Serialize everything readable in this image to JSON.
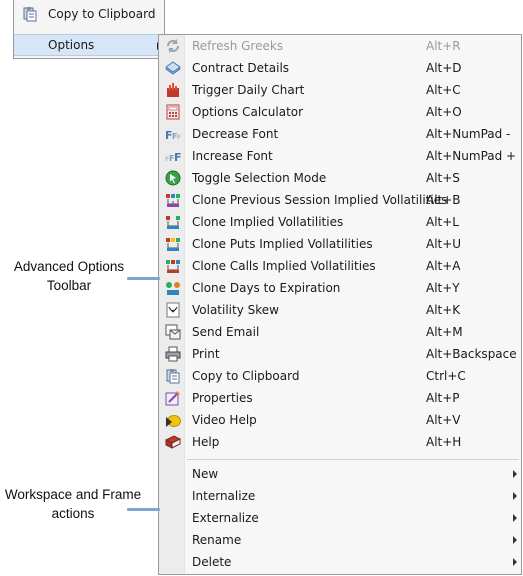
{
  "parent_menu": {
    "items": [
      {
        "label": "Copy to Clipboard",
        "icon": "clipboard-icon"
      },
      {
        "label": "Options",
        "icon": "",
        "has_submenu": true
      }
    ]
  },
  "submenu": {
    "items": [
      {
        "label": "Refresh Greeks",
        "shortcut": "Alt+R",
        "icon": "refresh-icon",
        "disabled": true
      },
      {
        "label": "Contract Details",
        "shortcut": "Alt+D",
        "icon": "contract-details-icon"
      },
      {
        "label": "Trigger Daily Chart",
        "shortcut": "Alt+C",
        "icon": "daily-chart-icon"
      },
      {
        "label": "Options Calculator",
        "shortcut": "Alt+O",
        "icon": "calculator-icon"
      },
      {
        "label": "Decrease Font",
        "shortcut": "Alt+NumPad -",
        "icon": "decrease-font-icon"
      },
      {
        "label": "Increase Font",
        "shortcut": "Alt+NumPad +",
        "icon": "increase-font-icon"
      },
      {
        "label": "Toggle Selection Mode",
        "shortcut": "Alt+S",
        "icon": "toggle-selection-icon"
      },
      {
        "label": "Clone Previous Session Implied Vollatilities",
        "shortcut": "Alt+B",
        "icon": "clone-previous-icon"
      },
      {
        "label": "Clone Implied Vollatilities",
        "shortcut": "Alt+L",
        "icon": "clone-implied-icon"
      },
      {
        "label": "Clone Puts Implied Vollatilities",
        "shortcut": "Alt+U",
        "icon": "clone-puts-icon"
      },
      {
        "label": "Clone Calls Implied Vollatilities",
        "shortcut": "Alt+A",
        "icon": "clone-calls-icon"
      },
      {
        "label": "Clone Days to Expiration",
        "shortcut": "Alt+Y",
        "icon": "clone-days-icon"
      },
      {
        "label": "Volatility Skew",
        "shortcut": "Alt+K",
        "icon": "volatility-skew-icon"
      },
      {
        "label": "Send Email",
        "shortcut": "Alt+M",
        "icon": "email-icon"
      },
      {
        "label": "Print",
        "shortcut": "Alt+Backspace",
        "icon": "printer-icon"
      },
      {
        "label": "Copy to Clipboard",
        "shortcut": "Ctrl+C",
        "icon": "clipboard-icon"
      },
      {
        "label": "Properties",
        "shortcut": "Alt+P",
        "icon": "properties-icon"
      },
      {
        "label": "Video Help",
        "shortcut": "Alt+V",
        "icon": "video-help-icon"
      },
      {
        "label": "Help",
        "shortcut": "Alt+H",
        "icon": "help-book-icon"
      }
    ],
    "workspace_items": [
      {
        "label": "New",
        "has_submenu": true
      },
      {
        "label": "Internalize",
        "has_submenu": true
      },
      {
        "label": "Externalize",
        "has_submenu": true
      },
      {
        "label": "Rename",
        "has_submenu": true
      },
      {
        "label": "Delete",
        "has_submenu": true
      }
    ]
  },
  "annotations": {
    "advanced_toolbar": "Advanced Options Toolbar",
    "workspace_frame": "Workspace and Frame actions"
  },
  "colors": {
    "menu_bg": "#f7f7f7",
    "highlight": "#d6e6f7",
    "disabled_text": "#9a9a9a",
    "annotation_line": "#7fa4cf"
  }
}
